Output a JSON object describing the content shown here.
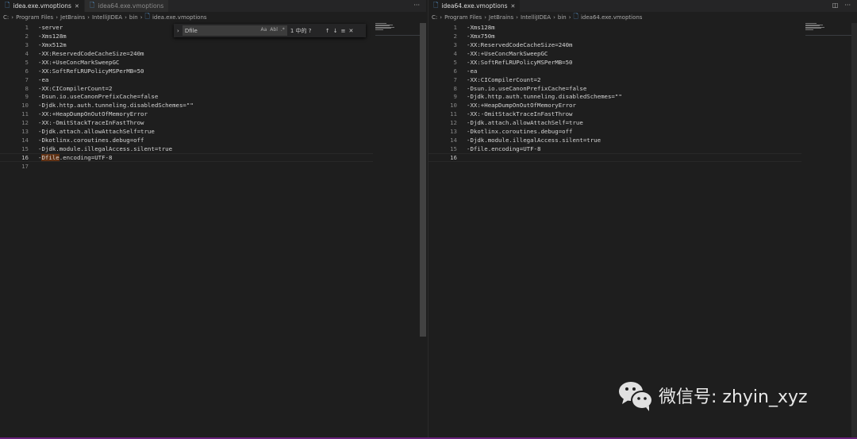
{
  "left": {
    "tabs": [
      {
        "label": "idea.exe.vmoptions",
        "active": true
      },
      {
        "label": "idea64.exe.vmoptions",
        "active": false
      }
    ],
    "breadcrumb": [
      "C:",
      "Program Files",
      "JetBrains",
      "IntelliJIDEA",
      "bin",
      "idea.exe.vmoptions"
    ],
    "lines": [
      "-server",
      "-Xms128m",
      "-Xmx512m",
      "-XX:ReservedCodeCacheSize=240m",
      "-XX:+UseConcMarkSweepGC",
      "-XX:SoftRefLRUPolicyMSPerMB=50",
      "-ea",
      "-XX:CICompilerCount=2",
      "-Dsun.io.useCanonPrefixCache=false",
      "-Djdk.http.auth.tunneling.disabledSchemes=\"\"",
      "-XX:+HeapDumpOnOutOfMemoryError",
      "-XX:-OmitStackTraceInFastThrow",
      "-Djdk.attach.allowAttachSelf=true",
      "-Dkotlinx.coroutines.debug=off",
      "-Djdk.module.illegalAccess.silent=true",
      "-Dfile.encoding=UTF-8",
      ""
    ],
    "current_line": 16,
    "find": {
      "query": "Dfile",
      "result": "1 中的 ?",
      "match_case": "Aa",
      "whole_word": "Abl",
      "regex": ".*"
    }
  },
  "right": {
    "tabs": [
      {
        "label": "idea64.exe.vmoptions",
        "active": true
      }
    ],
    "breadcrumb": [
      "C:",
      "Program Files",
      "JetBrains",
      "IntelliJIDEA",
      "bin",
      "idea64.exe.vmoptions"
    ],
    "lines": [
      "-Xms128m",
      "-Xmx750m",
      "-XX:ReservedCodeCacheSize=240m",
      "-XX:+UseConcMarkSweepGC",
      "-XX:SoftRefLRUPolicyMSPerMB=50",
      "-ea",
      "-XX:CICompilerCount=2",
      "-Dsun.io.useCanonPrefixCache=false",
      "-Djdk.http.auth.tunneling.disabledSchemes=\"\"",
      "-XX:+HeapDumpOnOutOfMemoryError",
      "-XX:-OmitStackTraceInFastThrow",
      "-Djdk.attach.allowAttachSelf=true",
      "-Dkotlinx.coroutines.debug=off",
      "-Djdk.module.illegalAccess.silent=true",
      "-Dfile.encoding=UTF-8",
      ""
    ],
    "current_line": 16
  },
  "watermark": {
    "text": "微信号: zhyin_xyz",
    "icon": "wechat-icon"
  },
  "colors": {
    "editor_bg": "#1e1e1e",
    "status_bar": "#68217a",
    "find_highlight": "#613214"
  }
}
